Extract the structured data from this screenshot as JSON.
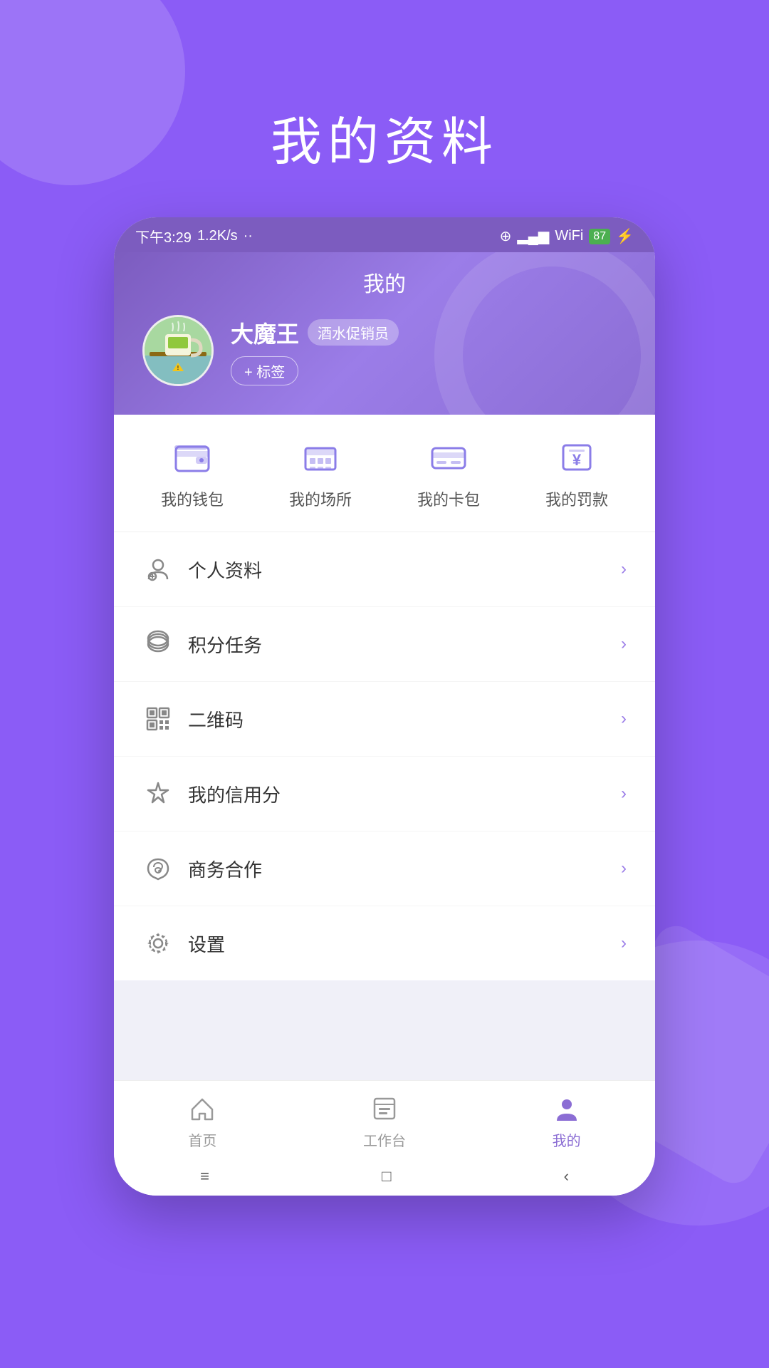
{
  "background": {
    "color": "#8B5CF6"
  },
  "page_title": "我的资料",
  "status_bar": {
    "time": "下午3:29",
    "speed": "1.2K/s",
    "battery": "87"
  },
  "header": {
    "title": "我的",
    "user": {
      "name": "大魔王",
      "badge": "酒水促销员",
      "tag_button": "+ 标签"
    }
  },
  "quick_actions": [
    {
      "id": "wallet",
      "label": "我的钱包"
    },
    {
      "id": "venue",
      "label": "我的场所"
    },
    {
      "id": "card",
      "label": "我的卡包"
    },
    {
      "id": "penalty",
      "label": "我的罚款"
    }
  ],
  "menu_items": [
    {
      "id": "profile",
      "label": "个人资料"
    },
    {
      "id": "points",
      "label": "积分任务"
    },
    {
      "id": "qrcode",
      "label": "二维码"
    },
    {
      "id": "credit",
      "label": "我的信用分"
    },
    {
      "id": "business",
      "label": "商务合作"
    },
    {
      "id": "settings",
      "label": "设置"
    }
  ],
  "bottom_nav": [
    {
      "id": "home",
      "label": "首页",
      "active": false
    },
    {
      "id": "workbench",
      "label": "工作台",
      "active": false
    },
    {
      "id": "mine",
      "label": "我的",
      "active": true
    }
  ],
  "android_nav": {
    "menu": "≡",
    "home": "□",
    "back": "‹"
  }
}
